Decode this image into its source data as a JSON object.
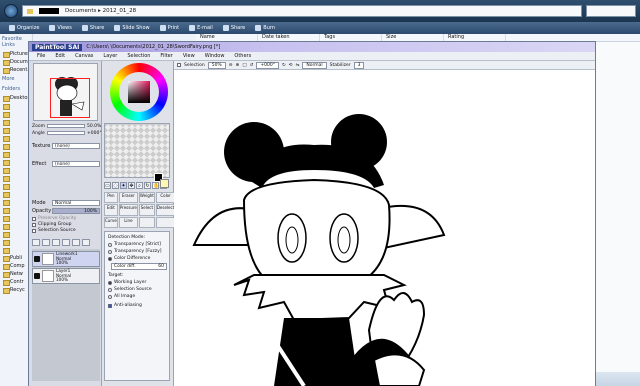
{
  "explorer": {
    "address_path": "Documents  ▸  2012_01_28",
    "toolbar": [
      "Organize",
      "Views",
      "Share",
      "Slide Show",
      "Print",
      "E-mail",
      "Share",
      "Burn"
    ],
    "columns": [
      "Name",
      "Date taken",
      "Tags",
      "Size",
      "Rating"
    ],
    "nav": {
      "favorite_links": "Favorite Links",
      "favorites": [
        "Pictures",
        "Docume...",
        "Recent..."
      ],
      "more": "More",
      "folders_label": "Folders",
      "tree": [
        "Desktop",
        "",
        "",
        "",
        "",
        "",
        "",
        "",
        "",
        "",
        "",
        "",
        "",
        "",
        "",
        "",
        "",
        "",
        "",
        "",
        "Publi",
        "Comp",
        "Netw",
        "Contr",
        "Recyc"
      ]
    }
  },
  "sai": {
    "app_name": "PaintTool SAI",
    "window_title": "C:\\Users\\        \\Documents\\2012_01_28\\SwordFairy.png [*]",
    "menu": [
      "File",
      "Edit",
      "Canvas",
      "Layer",
      "Selection",
      "Filter",
      "View",
      "Window",
      "Others"
    ],
    "navigator": {
      "zoom_label": "Zoom",
      "zoom_value": "50.0%",
      "angle_label": "Angle",
      "angle_value": "+000°"
    },
    "layer_props": {
      "texture_label": "Texture",
      "texture_value": "(none)",
      "effect_label": "Effect",
      "effect_value": "(none)",
      "mode_label": "Mode",
      "mode_value": "Normal",
      "opacity_label": "Opacity",
      "opacity_value": "100%",
      "preserve_opacity": "Preserve Opacity",
      "clipping_group": "Clipping Group",
      "selection_source": "Selection Source"
    },
    "layers": [
      {
        "name": "Linework1",
        "mode": "Normal",
        "opacity": "100%",
        "selected": true
      },
      {
        "name": "Layer1",
        "mode": "Normal",
        "opacity": "100%",
        "selected": false
      }
    ],
    "tools": {
      "brushes": [
        "Pen",
        "Eraser",
        "Weight",
        "Color",
        "Edit",
        "Pressure",
        "Select",
        "Deselect",
        "Curve",
        "Line",
        "",
        ""
      ]
    },
    "tool_options": {
      "detection_mode_label": "Detection Mode:",
      "modes": [
        {
          "label": "Transparency [Strict]",
          "selected": false
        },
        {
          "label": "Transparency [Fuzzy]",
          "selected": false
        },
        {
          "label": "Color Difference",
          "selected": true
        }
      ],
      "color_diff_label": "Color diff.",
      "color_diff_value": "60",
      "target_label": "Target:",
      "targets": [
        {
          "label": "Working Layer",
          "selected": true
        },
        {
          "label": "Selection Source",
          "selected": false
        },
        {
          "label": "All Image",
          "selected": false
        }
      ],
      "anti_aliasing": "Anti-aliasing",
      "anti_aliasing_on": true
    },
    "canvas_toolbar": {
      "selection_label": "Selection",
      "zoom_value": "50%",
      "angle_value": "+000°",
      "blend_value": "Normal",
      "stabilizer_label": "Stabilizer",
      "stabilizer_value": "3"
    }
  },
  "colors": {
    "sai_title": "#9a91d9",
    "canvas": "#ffffff",
    "nav_box": "#ff2020",
    "selected_layer": "#cfd4f0",
    "fg": "#000000",
    "bg": "#fff8b4"
  }
}
